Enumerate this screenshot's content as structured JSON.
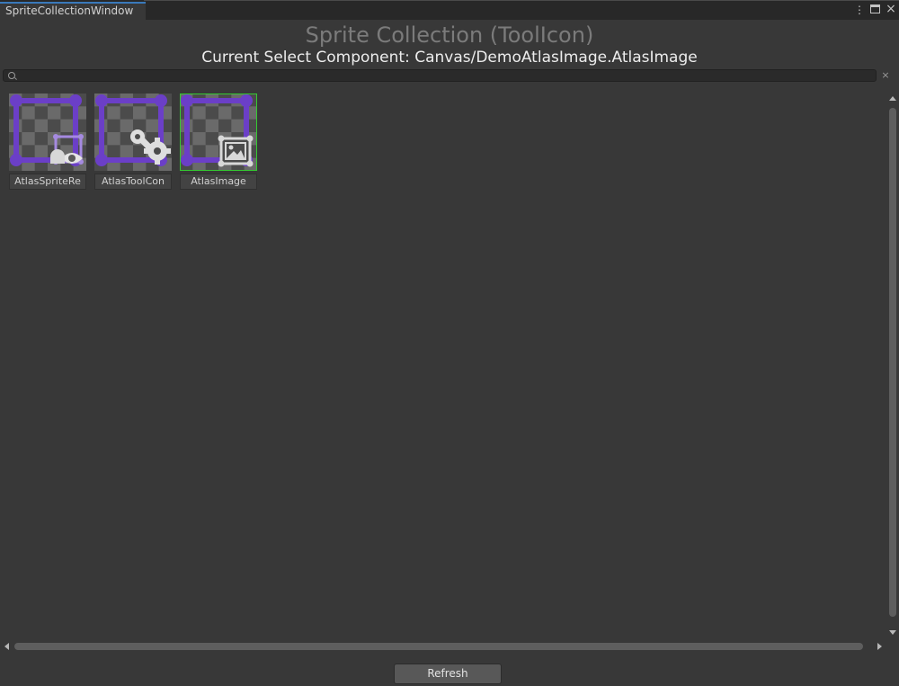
{
  "window": {
    "tab_title": "SpriteCollectionWindow",
    "menu_glyph": "⋮",
    "close_glyph": "×"
  },
  "header": {
    "title": "Sprite Collection (ToolIcon)",
    "subtitle": "Current Select Component: Canvas/DemoAtlasImage.AtlasImage"
  },
  "search": {
    "value": "",
    "placeholder": "",
    "clear_glyph": "×"
  },
  "sprites": [
    {
      "label": "AtlasSpriteRe",
      "icon": "atlas-sprite-eye-icon",
      "selected": false
    },
    {
      "label": "AtlasToolCon",
      "icon": "wrench-gear-icon",
      "selected": false
    },
    {
      "label": "AtlasImage",
      "icon": "image-frame-icon",
      "selected": true
    }
  ],
  "colors": {
    "accent_purple": "#6b3fc7",
    "selection_green": "#35c932",
    "tab_accent": "#3a79bb"
  },
  "footer": {
    "refresh_label": "Refresh"
  }
}
